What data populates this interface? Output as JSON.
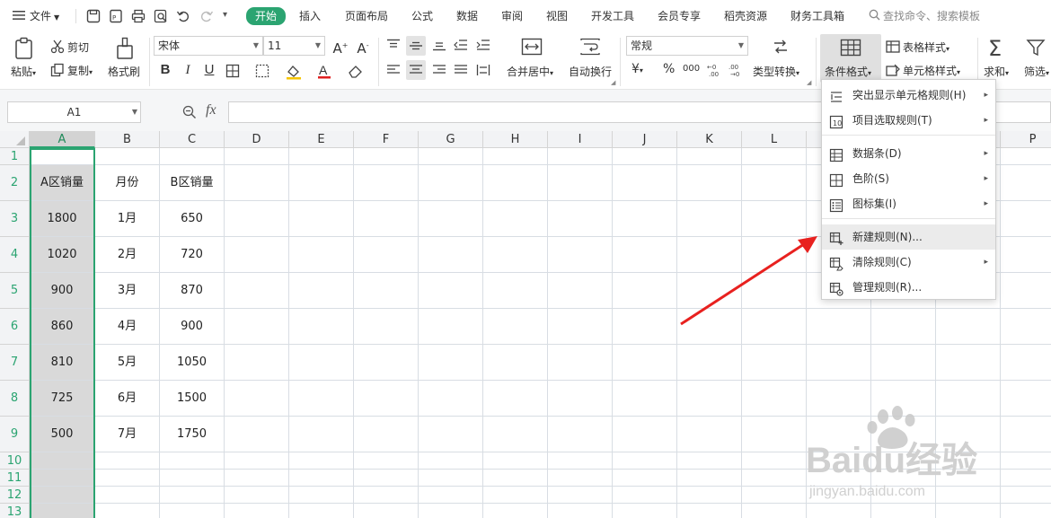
{
  "menu": {
    "file": "文件",
    "tabs": [
      "开始",
      "插入",
      "页面布局",
      "公式",
      "数据",
      "审阅",
      "视图",
      "开发工具",
      "会员专享",
      "稻壳资源",
      "财务工具箱"
    ],
    "active_tab": "开始",
    "search_placeholder": "查找命令、搜索模板"
  },
  "ribbon": {
    "paste": "粘贴",
    "cut": "剪切",
    "copy": "复制",
    "format_painter": "格式刷",
    "font_name": "宋体",
    "font_size": "11",
    "merge_center": "合并居中",
    "wrap_text": "自动换行",
    "number_format": "常规",
    "currency_symbol": "¥",
    "percent_symbol": "%",
    "thousands_symbol": "000",
    "type_convert": "类型转换",
    "conditional_format": "条件格式",
    "table_style": "表格样式",
    "cell_style": "单元格样式",
    "sum": "求和",
    "filter": "筛选"
  },
  "formula_bar": {
    "name_box": "A1",
    "fx": "fx",
    "formula": ""
  },
  "sheet": {
    "columns": [
      "A",
      "B",
      "C",
      "D",
      "E",
      "F",
      "G",
      "H",
      "I",
      "J",
      "K",
      "L",
      "M",
      "N",
      "O",
      "P"
    ],
    "rows": [
      "1",
      "2",
      "3",
      "4",
      "5",
      "6",
      "7",
      "8",
      "9",
      "10",
      "11",
      "12",
      "13"
    ],
    "selected_column": "A",
    "cells": {
      "A2": "A区销量",
      "B2": "月份",
      "C2": "B区销量",
      "A3": "1800",
      "B3": "1月",
      "C3": "650",
      "A4": "1020",
      "B4": "2月",
      "C4": "720",
      "A5": "900",
      "B5": "3月",
      "C5": "870",
      "A6": "860",
      "B6": "4月",
      "C6": "900",
      "A7": "810",
      "B7": "5月",
      "C7": "1050",
      "A8": "725",
      "B8": "6月",
      "C8": "1500",
      "A9": "500",
      "B9": "7月",
      "C9": "1750"
    }
  },
  "dropdown": {
    "items": [
      {
        "label": "突出显示单元格规则(H)",
        "icon": "highlight-rules-icon",
        "submenu": true
      },
      {
        "label": "项目选取规则(T)",
        "icon": "top-bottom-rules-icon",
        "submenu": true
      },
      {
        "label": "数据条(D)",
        "icon": "data-bars-icon",
        "submenu": true
      },
      {
        "label": "色阶(S)",
        "icon": "color-scale-icon",
        "submenu": true
      },
      {
        "label": "图标集(I)",
        "icon": "icon-sets-icon",
        "submenu": true
      },
      {
        "label": "新建规则(N)...",
        "icon": "new-rule-icon",
        "submenu": false,
        "highlighted": true
      },
      {
        "label": "清除规则(C)",
        "icon": "clear-rules-icon",
        "submenu": true
      },
      {
        "label": "管理规则(R)...",
        "icon": "manage-rules-icon",
        "submenu": false
      }
    ]
  },
  "annotation": {
    "color": "#e8211f"
  },
  "watermark": {
    "brand": "Baidu经验",
    "url": "jingyan.baidu.com"
  },
  "colors": {
    "accent": "#2ba471",
    "selected_col_bg": "#d9d9d9"
  }
}
